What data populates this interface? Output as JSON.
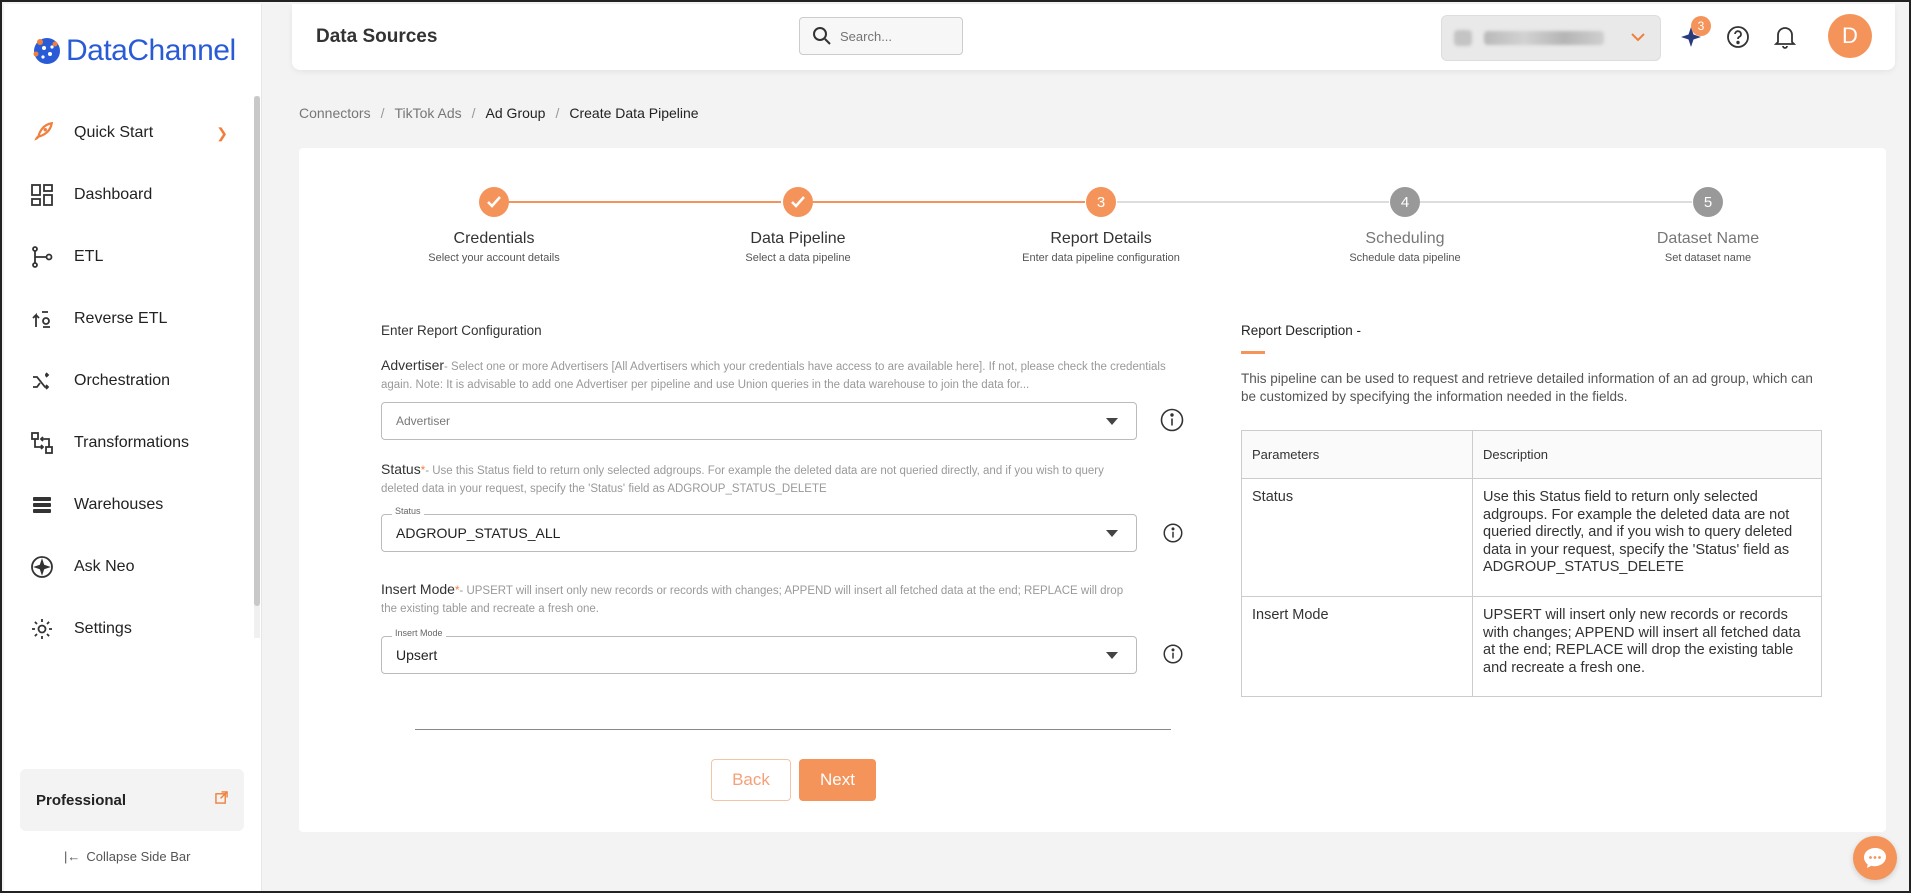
{
  "brand": {
    "name_part1": "Data",
    "name_part2": "Channel",
    "accent": "#f4935a"
  },
  "sidebar": {
    "items": [
      {
        "label": "Quick Start",
        "icon": "rocket-icon"
      },
      {
        "label": "Dashboard",
        "icon": "dashboard-icon"
      },
      {
        "label": "ETL",
        "icon": "etl-icon"
      },
      {
        "label": "Reverse ETL",
        "icon": "reverse-etl-icon"
      },
      {
        "label": "Orchestration",
        "icon": "orchestration-icon"
      },
      {
        "label": "Transformations",
        "icon": "transformations-icon"
      },
      {
        "label": "Warehouses",
        "icon": "warehouses-icon"
      },
      {
        "label": "Ask Neo",
        "icon": "ask-neo-icon"
      },
      {
        "label": "Settings",
        "icon": "gear-icon"
      }
    ],
    "plan": "Professional",
    "collapse": "Collapse Side Bar"
  },
  "header": {
    "title": "Data Sources",
    "search_placeholder": "Search...",
    "notification_count": "3",
    "avatar_letter": "D"
  },
  "breadcrumb": [
    "Connectors",
    "TikTok Ads",
    "Ad Group",
    "Create Data Pipeline"
  ],
  "stepper": [
    {
      "number": "✓",
      "title": "Credentials",
      "subtitle": "Select your account details",
      "state": "done"
    },
    {
      "number": "✓",
      "title": "Data Pipeline",
      "subtitle": "Select a data pipeline",
      "state": "done"
    },
    {
      "number": "3",
      "title": "Report Details",
      "subtitle": "Enter data pipeline configuration",
      "state": "active"
    },
    {
      "number": "4",
      "title": "Scheduling",
      "subtitle": "Schedule data pipeline",
      "state": "inactive"
    },
    {
      "number": "5",
      "title": "Dataset Name",
      "subtitle": "Set dataset name",
      "state": "inactive"
    }
  ],
  "form": {
    "section_title": "Enter Report Configuration",
    "advertiser": {
      "label": "Advertiser",
      "help": "- Select one or more Advertisers [All Advertisers which your credentials have access to are available here]. If not, please check the credentials again. Note: It is advisable to add one Advertiser per pipeline and use Union queries in the data warehouse to join the data for...",
      "placeholder": "Advertiser"
    },
    "status": {
      "label": "Status",
      "required": "*",
      "help": "- Use this Status field to return only selected adgroups. For example the deleted data are not queried directly, and if you wish to query deleted data in your request, specify the 'Status' field as ADGROUP_STATUS_DELETE",
      "floating_label": "Status",
      "value": "ADGROUP_STATUS_ALL"
    },
    "insert_mode": {
      "label": "Insert Mode",
      "required": "*",
      "help": "- UPSERT will insert only new records or records with changes; APPEND will insert all fetched data at the end; REPLACE will drop the existing table and recreate a fresh one.",
      "floating_label": "Insert Mode",
      "value": "Upsert"
    },
    "back_label": "Back",
    "next_label": "Next"
  },
  "description": {
    "title": "Report Description -",
    "text": "This pipeline can be used to request and retrieve detailed information of an ad group, which can be customized by specifying the information needed in the fields.",
    "table_headers": [
      "Parameters",
      "Description"
    ],
    "rows": [
      {
        "param": "Status",
        "desc": "Use this Status field to return only selected adgroups. For example the deleted data are not queried directly, and if you wish to query deleted data in your request, specify the 'Status' field as ADGROUP_STATUS_DELETE"
      },
      {
        "param": "Insert Mode",
        "desc": "UPSERT will insert only new records or records with changes; APPEND will insert all fetched data at the end; REPLACE will drop the existing table and recreate a fresh one."
      }
    ]
  }
}
